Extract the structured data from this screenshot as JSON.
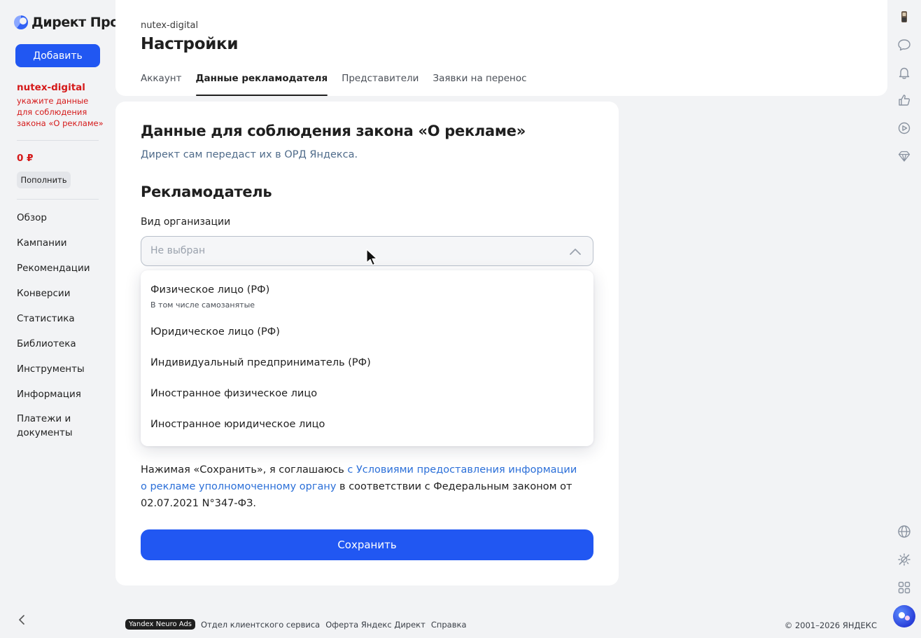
{
  "sidebar": {
    "logo_text": "Директ Про",
    "add_label": "Добавить",
    "account_name": "nutex-digital",
    "account_warning": "укажите данные для соблюдения закона «О рекламе»",
    "balance": "0 ₽",
    "topup_label": "Пополнить",
    "nav": [
      {
        "label": "Обзор"
      },
      {
        "label": "Кампании"
      },
      {
        "label": "Рекомендации"
      },
      {
        "label": "Конверсии"
      },
      {
        "label": "Статистика"
      },
      {
        "label": "Библиотека"
      },
      {
        "label": "Инструменты"
      },
      {
        "label": "Информация"
      },
      {
        "label": "Платежи и документы"
      }
    ],
    "collapse_icon": "chevron-left-icon"
  },
  "header": {
    "account": "nutex-digital",
    "title": "Настройки",
    "tabs": [
      {
        "label": "Аккаунт",
        "active": false
      },
      {
        "label": "Данные рекламодателя",
        "active": true
      },
      {
        "label": "Представители",
        "active": false
      },
      {
        "label": "Заявки на перенос",
        "active": false
      }
    ]
  },
  "form": {
    "title": "Данные для соблюдения закона «О рекламе»",
    "subtitle": "Директ сам передаст их в ОРД Яндекса.",
    "advertiser_title": "Рекламодатель",
    "org_type_label": "Вид организации",
    "org_type_placeholder": "Не выбран",
    "options": [
      {
        "label": "Физическое лицо (РФ)",
        "sub": "В том числе самозанятые"
      },
      {
        "label": "Юридическое лицо (РФ)",
        "sub": ""
      },
      {
        "label": "Индивидуальный предприниматель (РФ)",
        "sub": ""
      },
      {
        "label": "Иностранное физическое лицо",
        "sub": ""
      },
      {
        "label": "Иностранное юридическое лицо",
        "sub": ""
      }
    ],
    "consent_prefix": "Нажимая «Сохранить», я соглашаюсь ",
    "consent_link": "с Условиями предоставления информации о рекламе уполномоченному органу",
    "consent_suffix": " в соответствии с Федеральным законом от 02.07.2021 N°347-ФЗ.",
    "save_label": "Сохранить"
  },
  "rail": {
    "icons": [
      "avatar-icon",
      "chat-icon",
      "bell-icon",
      "thumbs-up-icon",
      "play-icon",
      "diamond-icon",
      "globe-icon",
      "theme-icon",
      "apps-grid-icon",
      "ai-assistant-icon"
    ]
  },
  "footer": {
    "badge": "Yandex Neuro Ads",
    "links": [
      "Отдел клиентского сервиса",
      "Оферта Яндекс Директ",
      "Справка"
    ],
    "copyright": "© 2001–2026 ЯНДЕКС"
  },
  "colors": {
    "accent": "#2157f2",
    "warning": "#d51a1a",
    "link": "#2b6fd8",
    "background": "#f2f3f5"
  }
}
